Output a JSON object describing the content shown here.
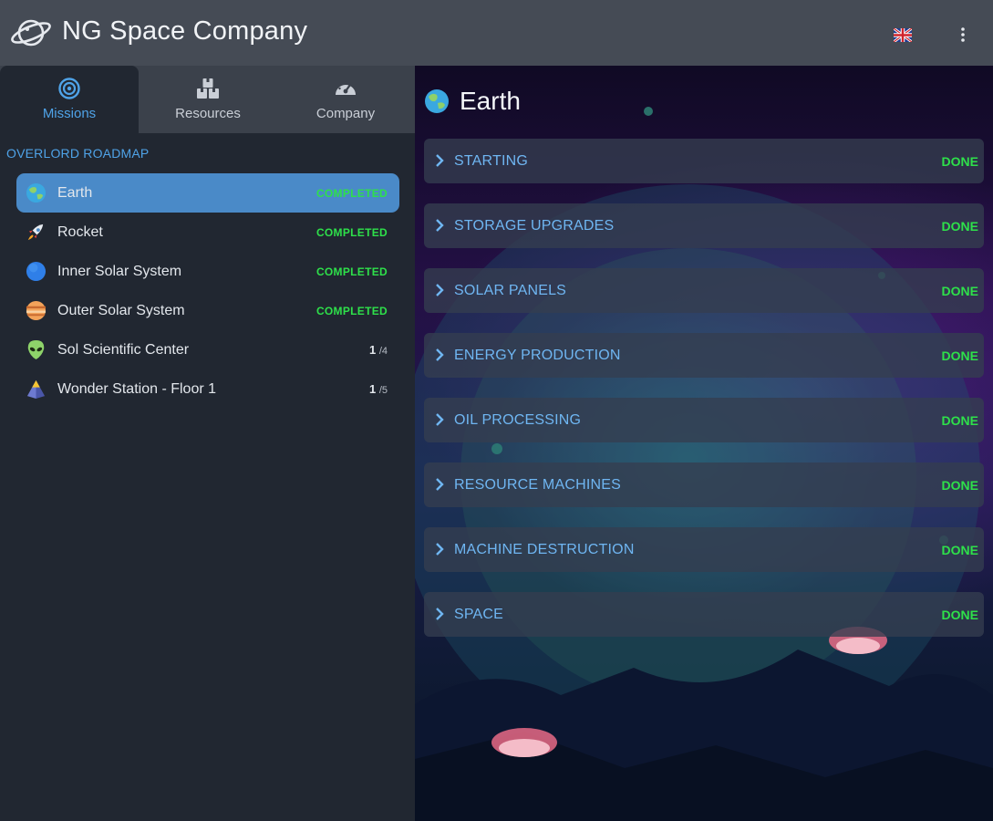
{
  "app": {
    "title": "NG Space Company"
  },
  "header": {
    "language_icon": "uk-flag-icon",
    "menu_icon": "vertical-dots-icon"
  },
  "tabs": [
    {
      "label": "Missions",
      "icon": "target-icon",
      "active": true
    },
    {
      "label": "Resources",
      "icon": "boxes-icon",
      "active": false
    },
    {
      "label": "Company",
      "icon": "gauge-icon",
      "active": false
    }
  ],
  "sidebar": {
    "section_title": "OVERLORD ROADMAP",
    "missions": [
      {
        "label": "Earth",
        "icon": "earth-icon",
        "status": "COMPLETED",
        "active": true
      },
      {
        "label": "Rocket",
        "icon": "rocket-icon",
        "status": "COMPLETED"
      },
      {
        "label": "Inner Solar System",
        "icon": "blue-planet-icon",
        "status": "COMPLETED"
      },
      {
        "label": "Outer Solar System",
        "icon": "jupiter-icon",
        "status": "COMPLETED"
      },
      {
        "label": "Sol Scientific Center",
        "icon": "alien-icon",
        "progress": "1",
        "total": "/4"
      },
      {
        "label": "Wonder Station - Floor 1",
        "icon": "pyramid-icon",
        "progress": "1",
        "total": "/5"
      }
    ]
  },
  "main": {
    "title": "Earth",
    "title_icon": "earth-icon",
    "sections": [
      {
        "label": "STARTING",
        "status": "DONE"
      },
      {
        "label": "STORAGE UPGRADES",
        "status": "DONE"
      },
      {
        "label": "SOLAR PANELS",
        "status": "DONE"
      },
      {
        "label": "ENERGY PRODUCTION",
        "status": "DONE"
      },
      {
        "label": "OIL PROCESSING",
        "status": "DONE"
      },
      {
        "label": "RESOURCE MACHINES",
        "status": "DONE"
      },
      {
        "label": "MACHINE DESTRUCTION",
        "status": "DONE"
      },
      {
        "label": "SPACE",
        "status": "DONE"
      }
    ]
  },
  "colors": {
    "accent": "#4fa3e8",
    "success": "#2ee04a",
    "header_bg": "#454b55",
    "sidebar_bg": "#212731",
    "active_item": "#4a8ac8"
  }
}
